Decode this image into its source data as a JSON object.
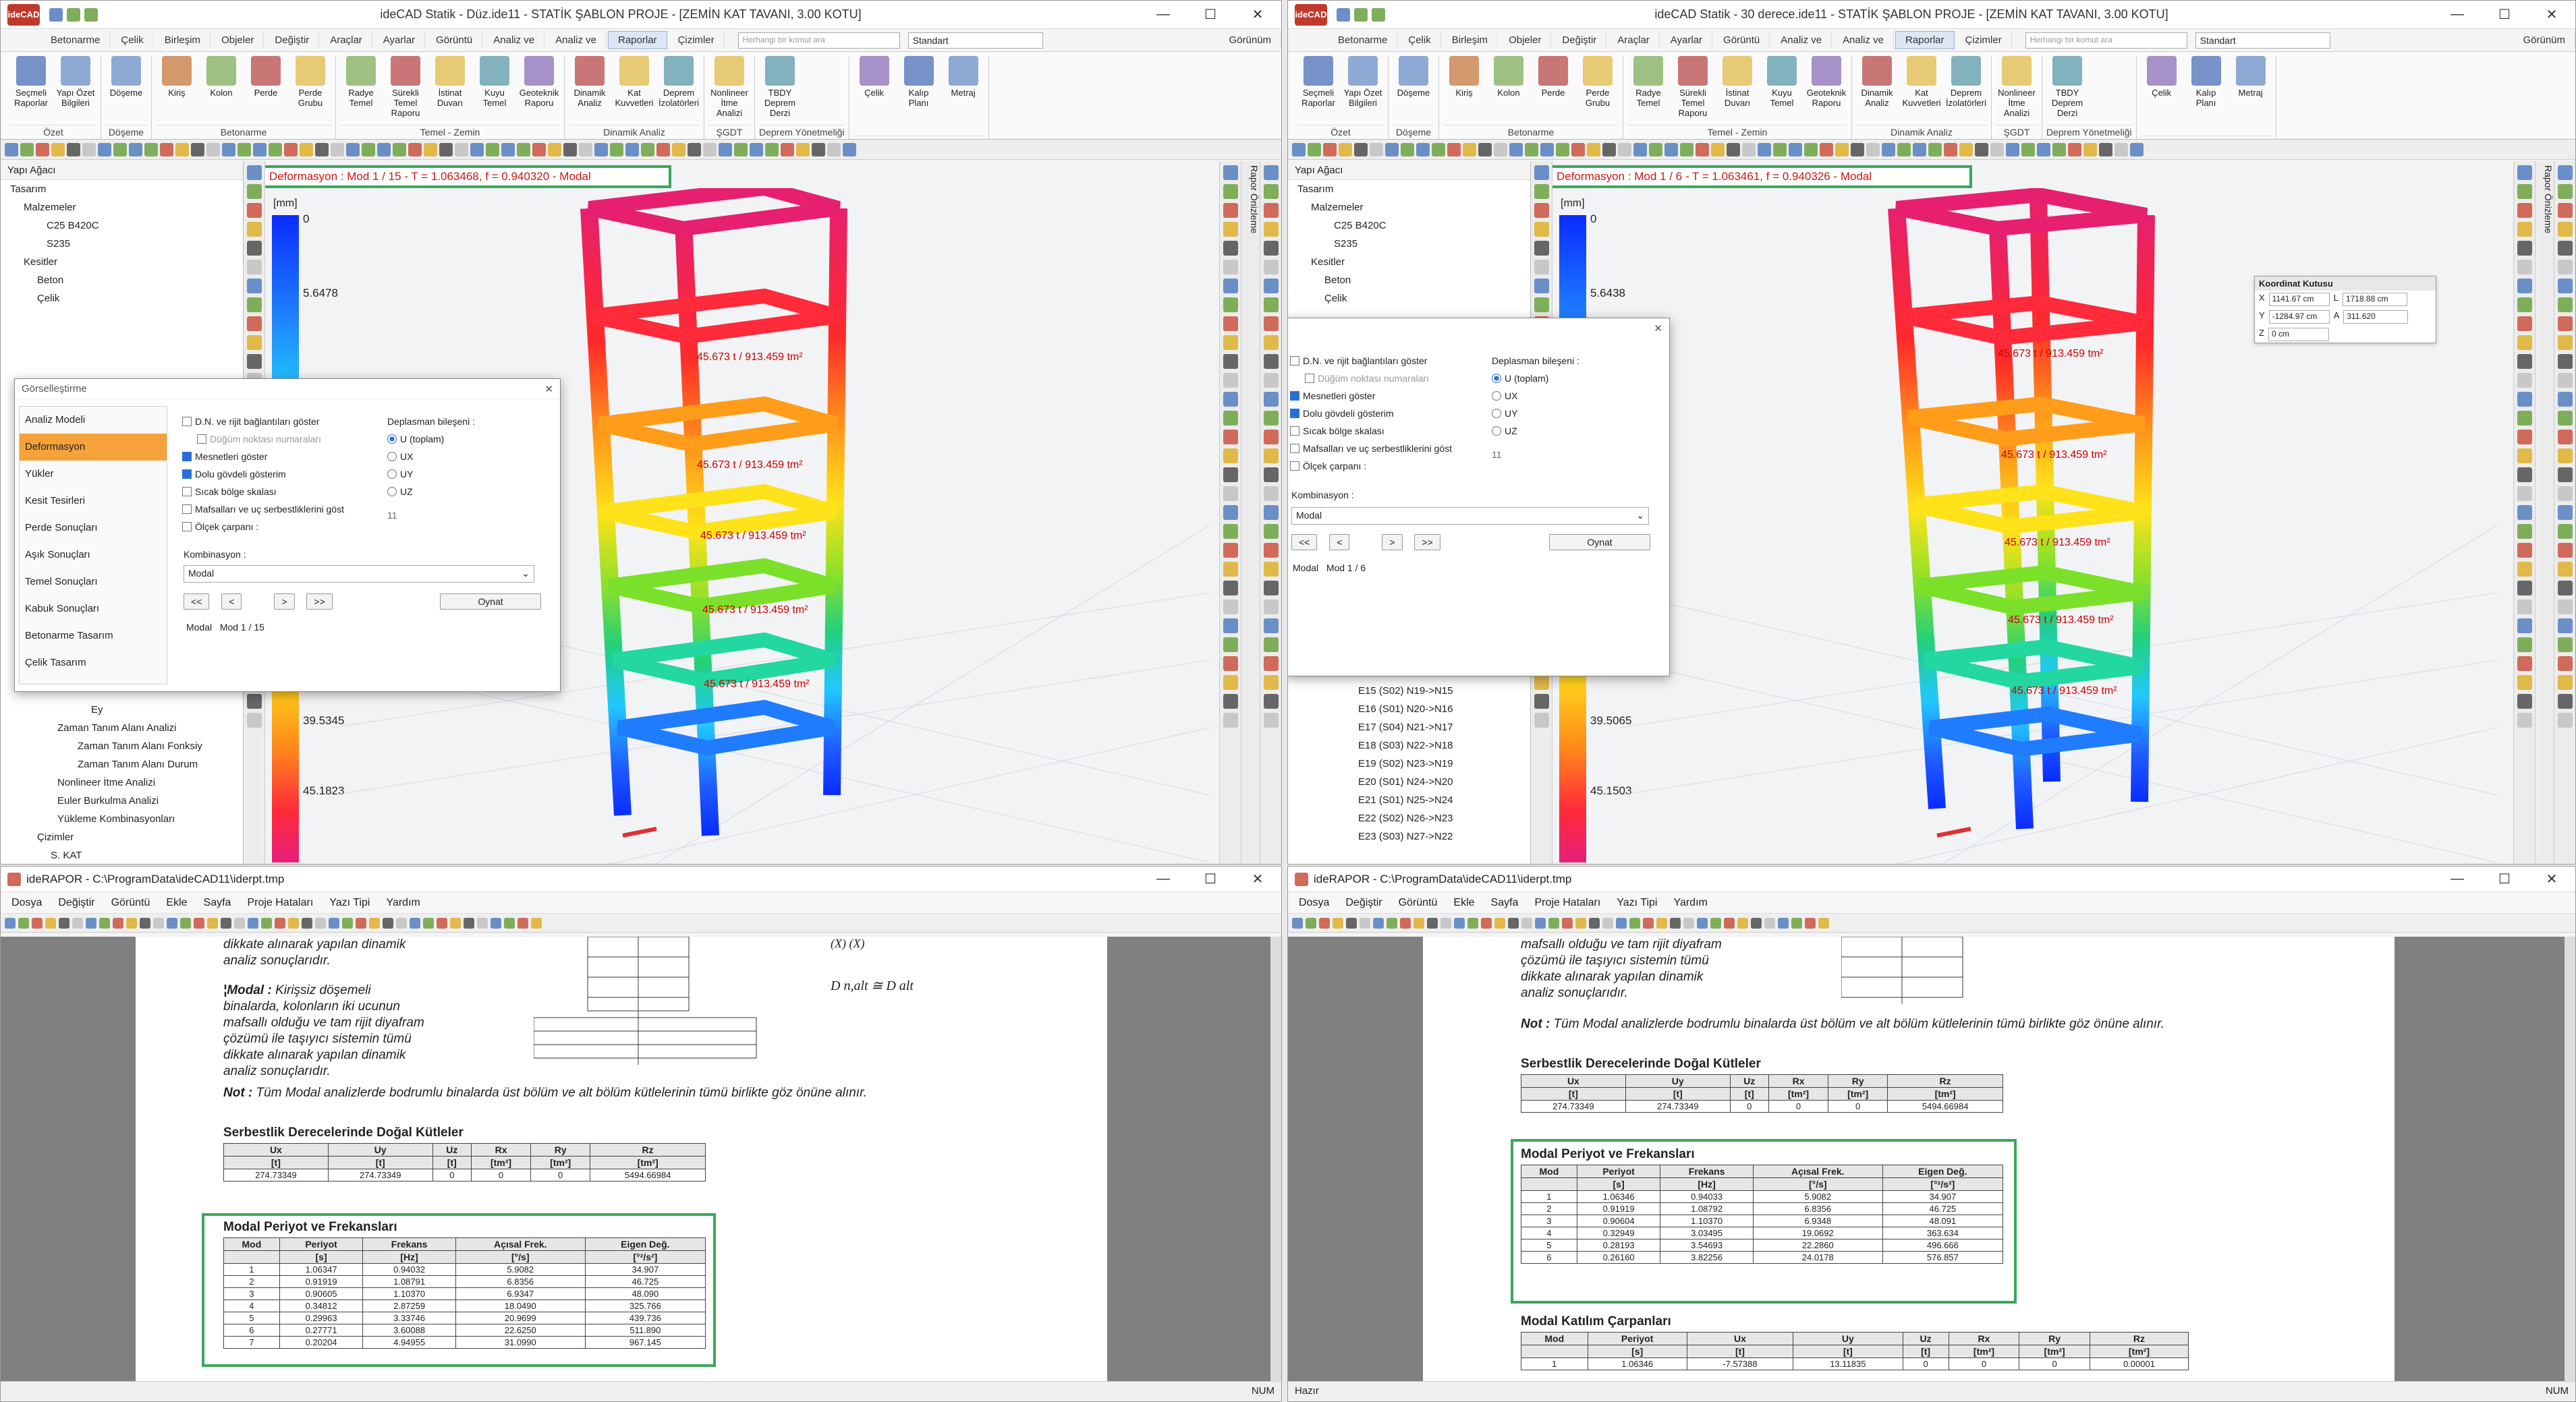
{
  "ribbon": {
    "tabs": [
      "Betonarme",
      "Çelik",
      "Birleşim",
      "Objeler",
      "Değiştir",
      "Araçlar",
      "Ayarlar",
      "Görüntü",
      "Analiz ve",
      "Analiz ve",
      "Raporlar",
      "Çizimler"
    ],
    "active_tab": "Raporlar",
    "search_placeholder": "Herhangi bir komut ara",
    "style_combo": "Standart",
    "view_label": "Görünüm",
    "groups": [
      {
        "title": "Özet",
        "buttons": [
          "Seçmeli Raporlar",
          "Yapı Özet Bilgileri"
        ]
      },
      {
        "title": "Döşeme",
        "buttons": [
          "Döşeme"
        ]
      },
      {
        "title": "Betonarme",
        "buttons": [
          "Kiriş",
          "Kolon",
          "Perde",
          "Perde Grubu"
        ]
      },
      {
        "title": "Temel - Zemin",
        "buttons": [
          "Radye Temel",
          "Sürekli Temel Raporu",
          "İstinat Duvarı",
          "Kuyu Temel",
          "Geoteknik Raporu"
        ]
      },
      {
        "title": "Dinamik Analiz",
        "buttons": [
          "Dinamik Analiz",
          "Kat Kuvvetleri",
          "Deprem İzolatörleri"
        ]
      },
      {
        "title": "ŞGDT",
        "buttons": [
          "Nonlineer İtme Analizi"
        ]
      },
      {
        "title": "Deprem Yönetmeliği",
        "buttons": [
          "TBDY Deprem Derzi"
        ]
      },
      {
        "title": "",
        "buttons": [
          "Çelik",
          "Kalıp Planı",
          "Metraj"
        ]
      }
    ]
  },
  "left_app": {
    "title": "ideCAD Statik - Düz.ide11 - STATİK ŞABLON PROJE - [ZEMİN KAT TAVANI,  3.00 KOTU]",
    "logo": "ideCAD",
    "tree_header": "Yapı Ağacı",
    "tree": [
      "Tasarım",
      "Malzemeler",
      "C25 B420C",
      "S235",
      "Kesitler",
      "Beton",
      "Çelik"
    ],
    "tree_bottom": [
      "Ey",
      "Zaman Tanım Alanı Analizi",
      "Zaman Tanım Alanı Fonksiy",
      "Zaman Tanım Alanı Durum",
      "Nonlineer İtme Analizi",
      "Euler Burkulma Analizi",
      "Yükleme Kombinasyonları",
      "Çizimler",
      "S. KAT"
    ],
    "info": "Deformasyon : Mod 1 / 15   -  T = 1.063468,  f = 0.940320  -  Modal",
    "unit": "[mm]",
    "legend": [
      "0",
      "5.6478",
      "39.5345",
      "45.1823"
    ],
    "beam_labels": [
      "45.673 t  /  913.459 tm²",
      "45.673 t  /  913.459 tm²",
      "45.673 t  /  913.459 tm²",
      "45.673 t  /  913.459 tm²",
      "45.673 t  /  913.459 tm²"
    ],
    "side_tab": "Rapor Önizleme",
    "dialog": {
      "title": "Görselleştirme",
      "sidebar": [
        "Analiz Modeli",
        "Deformasyon",
        "Yükler",
        "Kesit Tesirleri",
        "Perde Sonuçları",
        "Aşık Sonuçları",
        "Temel Sonuçları",
        "Kabuk Sonuçları",
        "Betonarme Tasarım",
        "Çelik Tasarım"
      ],
      "selected": "Deformasyon",
      "checks": [
        "D.N. ve rijit bağlantıları göster",
        "Düğüm noktası numaraları",
        "Mesnetleri göster",
        "Dolu gövdeli gösterim",
        "Sıcak bölge skalası",
        "Mafsalları ve uç serbestliklerini  göst",
        "Ölçek çarpanı :"
      ],
      "disp_title": "Deplasman bileşeni :",
      "disp": [
        "U (toplam)",
        "UX",
        "UY",
        "UZ"
      ],
      "scale": "11",
      "komb_label": "Kombinasyon :",
      "komb_value": "Modal",
      "nav": [
        "<<",
        "<",
        ">",
        ">>"
      ],
      "play": "Oynat",
      "mode_type": "Modal",
      "mode_value": "Mod 1 / 15"
    }
  },
  "right_app": {
    "title": "ideCAD Statik - 30 derece.ide11 - STATİK ŞABLON PROJE - [ZEMİN KAT TAVANI,  3.00 KOTU]",
    "logo": "ideCAD",
    "tree_header": "Yapı Ağacı",
    "tree": [
      "Tasarım",
      "Malzemeler",
      "C25 B420C",
      "S235",
      "Kesitler",
      "Beton",
      "Çelik"
    ],
    "tree_bottom": [
      "E15 (S02) N19->N15",
      "E16 (S01) N20->N16",
      "E17 (S04) N21->N17",
      "E18 (S03) N22->N18",
      "E19 (S02) N23->N19",
      "E20 (S01) N24->N20",
      "E21 (S01) N25->N24",
      "E22 (S02) N26->N23",
      "E23 (S03) N27->N22"
    ],
    "info": "Deformasyon : Mod 1 / 6   -  T = 1.063461,  f = 0.940326  -  Modal",
    "unit": "[mm]",
    "legend": [
      "0",
      "5.6438",
      "39.5065",
      "45.1503"
    ],
    "beam_labels": [
      "45.673 t  /  913.459 tm²",
      "45.673 t  /  913.459 tm²",
      "45.673 t  /  913.459 tm²",
      "45.673 t  /  913.459 tm²",
      "45.673 t  /  913.459 tm²"
    ],
    "side_tab": "Rapor Önizleme",
    "coord": {
      "title": "Koordinat Kutusu",
      "x": "1141.67 cm",
      "y": "-1284.97 cm",
      "z": "0 cm",
      "l": "1718.88 cm",
      "a": "311.620",
      "xl": "X",
      "yl": "Y",
      "zl": "Z",
      "ll": "L",
      "al": "A"
    },
    "dialog": {
      "checks": [
        "D.N. ve rijit bağlantıları göster",
        "Düğüm noktası numaraları",
        "Mesnetleri göster",
        "Dolu gövdeli gösterim",
        "Sıcak bölge skalası",
        "Mafsalları ve uç serbestliklerini  göst",
        "Ölçek çarpanı :"
      ],
      "disp_title": "Deplasman bileşeni :",
      "disp": [
        "U (toplam)",
        "UX",
        "UY",
        "UZ"
      ],
      "scale": "11",
      "komb_label": "Kombinasyon :",
      "komb_value": "Modal",
      "nav": [
        "<<",
        "<",
        ">",
        ">>"
      ],
      "play": "Oynat",
      "mode_type": "Modal",
      "mode_value": "Mod 1 / 6"
    }
  },
  "report_menu": [
    "Dosya",
    "Değiştir",
    "Görüntü",
    "Ekle",
    "Sayfa",
    "Proje Hataları",
    "Yazı Tipi",
    "Yardım"
  ],
  "left_report": {
    "title": "ideRAPOR - C:\\ProgramData\\ideCAD11\\iderpt.tmp",
    "status_right": "NUM",
    "para1": [
      "dikkate alınarak yapılan dinamik",
      "analiz sonuçlarıdır."
    ],
    "para2_bold": "¦Modal :",
    "para2": [
      " Kirişsiz döşemeli",
      "binalarda, kolonların iki ucunun",
      "mafsallı olduğu ve tam rijit diyafram",
      "çözümü ile taşıyıcı sistemin tümü",
      "dikkate alınarak yapılan dinamik",
      "analiz sonuçlarıdır."
    ],
    "formula1": "(X)    (X)",
    "formula2": "D n,alt  ≅  D alt",
    "note_bold": "Not :",
    "note": " Tüm Modal analizlerde bodrumlu binalarda üst bölüm ve alt bölüm kütlelerinin tümü birlikte göz önüne alınır.",
    "mass_title": "Serbestlik Derecelerinde Doğal Kütleler",
    "mass_head": [
      "Ux",
      "Uy",
      "Uz",
      "Rx",
      "Ry",
      "Rz"
    ],
    "mass_units": [
      "[t]",
      "[t]",
      "[t]",
      "[tm²]",
      "[tm²]",
      "[tm²]"
    ],
    "mass_row": [
      "274.73349",
      "274.73349",
      "0",
      "0",
      "0",
      "5494.66984"
    ],
    "modal_title": "Modal Periyot ve Frekansları",
    "modal_head": [
      "Mod",
      "Periyot",
      "Frekans",
      "Açısal Frek.",
      "Eigen Değ."
    ],
    "modal_units": [
      "",
      "[s]",
      "[Hz]",
      "[°/s]",
      "[°²/s²]"
    ],
    "modal_rows": [
      [
        "1",
        "1.06347",
        "0.94032",
        "5.9082",
        "34.907"
      ],
      [
        "2",
        "0.91919",
        "1.08791",
        "6.8356",
        "46.725"
      ],
      [
        "3",
        "0.90605",
        "1.10370",
        "6.9347",
        "48.090"
      ],
      [
        "4",
        "0.34812",
        "2.87259",
        "18.0490",
        "325.766"
      ],
      [
        "5",
        "0.29963",
        "3.33746",
        "20.9699",
        "439.736"
      ],
      [
        "6",
        "0.27771",
        "3.60088",
        "22.6250",
        "511.890"
      ],
      [
        "7",
        "0.20204",
        "4.94955",
        "31.0990",
        "967.145"
      ]
    ]
  },
  "right_report": {
    "title": "ideRAPOR - C:\\ProgramData\\ideCAD11\\iderpt.tmp",
    "status_left": "Hazır",
    "status_right": "NUM",
    "para": [
      "mafsallı olduğu ve tam rijit diyafram",
      "çözümü ile taşıyıcı sistemin tümü",
      "dikkate alınarak yapılan dinamik",
      "analiz sonuçlarıdır."
    ],
    "note_bold": "Not :",
    "note": " Tüm Modal analizlerde bodrumlu binalarda üst bölüm ve alt bölüm kütlelerinin tümü birlikte göz önüne alınır.",
    "mass_title": "Serbestlik Derecelerinde Doğal Kütleler",
    "mass_head": [
      "Ux",
      "Uy",
      "Uz",
      "Rx",
      "Ry",
      "Rz"
    ],
    "mass_units": [
      "[t]",
      "[t]",
      "[t]",
      "[tm²]",
      "[tm²]",
      "[tm²]"
    ],
    "mass_row": [
      "274.73349",
      "274.73349",
      "0",
      "0",
      "0",
      "5494.66984"
    ],
    "modal_title": "Modal Periyot ve Frekansları",
    "modal_head": [
      "Mod",
      "Periyot",
      "Frekans",
      "Açısal Frek.",
      "Eigen Değ."
    ],
    "modal_units": [
      "",
      "[s]",
      "[Hz]",
      "[°/s]",
      "[°²/s²]"
    ],
    "modal_rows": [
      [
        "1",
        "1.06346",
        "0.94033",
        "5.9082",
        "34.907"
      ],
      [
        "2",
        "0.91919",
        "1.08792",
        "6.8356",
        "46.725"
      ],
      [
        "3",
        "0.90604",
        "1.10370",
        "6.9348",
        "48.091"
      ],
      [
        "4",
        "0.32949",
        "3.03495",
        "19.0692",
        "363.634"
      ],
      [
        "5",
        "0.28193",
        "3.54693",
        "22.2860",
        "496.666"
      ],
      [
        "6",
        "0.26160",
        "3.82256",
        "24.0178",
        "576.857"
      ]
    ],
    "kat_title": "Modal Katılım Çarpanları",
    "kat_head": [
      "Mod",
      "Periyot",
      "Ux",
      "Uy",
      "Uz",
      "Rx",
      "Ry",
      "Rz"
    ],
    "kat_units": [
      "",
      "[s]",
      "[t]",
      "[t]",
      "[t]",
      "[tm²]",
      "[tm²]",
      "[tm²]"
    ],
    "kat_row": [
      "1",
      "1.06346",
      "-7.57388",
      "13.11835",
      "0",
      "0",
      "0",
      "0.00001"
    ]
  }
}
